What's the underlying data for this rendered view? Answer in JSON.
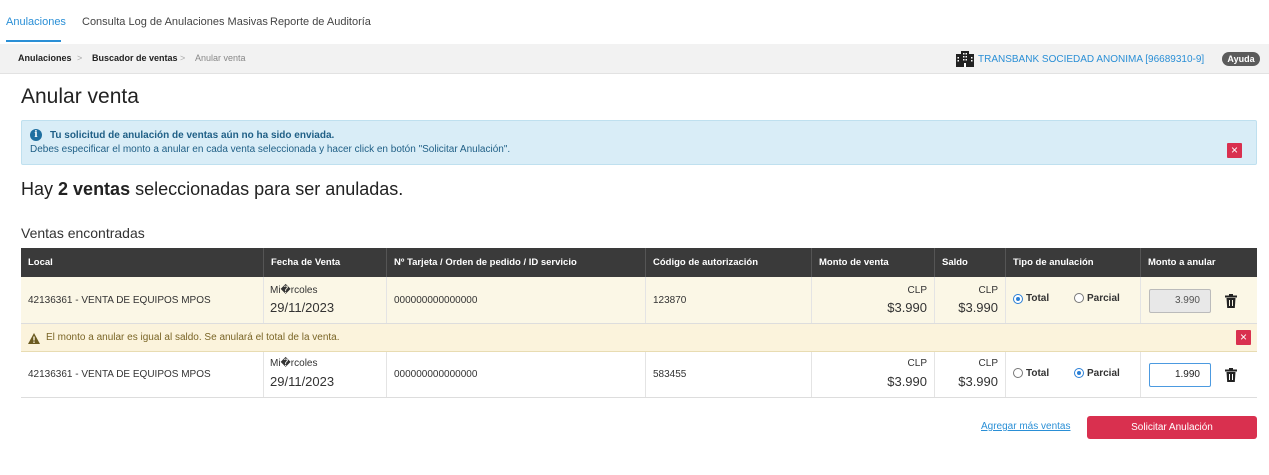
{
  "tabs": [
    {
      "label": "Anulaciones",
      "active": true
    },
    {
      "label": "Consulta Log de Anulaciones Masivas",
      "active": false
    },
    {
      "label": "Reporte de Auditoría",
      "active": false
    }
  ],
  "breadcrumb": {
    "items": [
      "Anulaciones",
      "Buscador de ventas",
      "Anular venta"
    ],
    "separator": ">"
  },
  "company": {
    "name": "TRANSBANK SOCIEDAD ANONIMA [96689310-9]",
    "icon": "building-icon"
  },
  "help_label": "Ayuda",
  "page_title": "Anular venta",
  "info_alert": {
    "title": "Tu solicitud de anulación de ventas aún no ha sido enviada.",
    "text": "Debes especificar el monto a anular en cada venta seleccionada y hacer click en botón \"Solicitar Anulación\".",
    "close": "×"
  },
  "summary": {
    "prefix": "Hay",
    "count": "2 ventas",
    "suffix": "seleccionadas para ser anuladas."
  },
  "section_title": "Ventas encontradas",
  "table": {
    "columns": [
      "Local",
      "Fecha de Venta",
      "Nº Tarjeta / Orden de pedido / ID servicio",
      "Código de autorización",
      "Monto de venta",
      "Saldo",
      "Tipo de anulación",
      "Monto a anular"
    ],
    "option_total": "Total",
    "option_partial": "Parcial",
    "rows": [
      {
        "local": "42136361 - VENTA DE EQUIPOS MPOS",
        "day": "Mi�rcoles",
        "date": "29/11/2023",
        "card": "000000000000000",
        "auth": "123870",
        "amount_currency": "CLP",
        "amount": "$3.990",
        "balance_currency": "CLP",
        "balance": "$3.990",
        "type": "total",
        "cancel_amount": "3.990"
      },
      {
        "local": "42136361 - VENTA DE EQUIPOS MPOS",
        "day": "Mi�rcoles",
        "date": "29/11/2023",
        "card": "000000000000000",
        "auth": "583455",
        "amount_currency": "CLP",
        "amount": "$3.990",
        "balance_currency": "CLP",
        "balance": "$3.990",
        "type": "partial",
        "cancel_amount": "1.990"
      }
    ],
    "warning": "El monto a anular es igual al saldo. Se anulará el total de la venta."
  },
  "actions": {
    "add_more": "Agregar más ventas",
    "submit": "Solicitar Anulación"
  },
  "colors": {
    "accent": "#2a8fd6",
    "danger": "#d9304f",
    "header_bg": "#3a3a3a",
    "info_bg": "#d9edf7",
    "warning_bg": "#fbf3dc"
  }
}
